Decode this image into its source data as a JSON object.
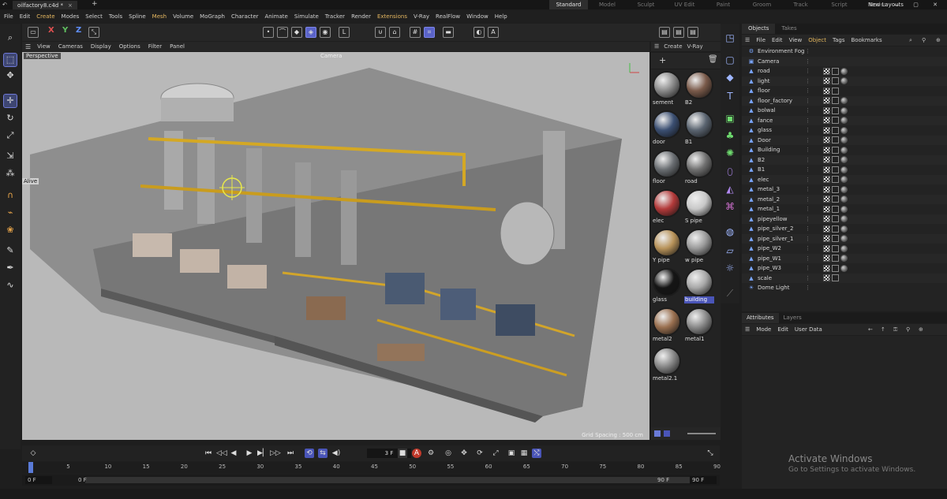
{
  "window": {
    "file_tab": "oilfactory8.c4d *",
    "close_glyph": "×",
    "plus_glyph": "+",
    "layouts": [
      "Standard",
      "Model",
      "Sculpt",
      "UV Edit",
      "Paint",
      "Groom",
      "Track",
      "Script",
      "Nodes"
    ],
    "active_layout": "Standard",
    "new_layouts": "New Layouts",
    "win_controls": "— ▢ ✕"
  },
  "menubar": [
    "File",
    "Edit",
    "Create",
    "Modes",
    "Select",
    "Tools",
    "Spline",
    "Mesh",
    "Volume",
    "MoGraph",
    "Character",
    "Animate",
    "Simulate",
    "Tracker",
    "Render",
    "Extensions",
    "V-Ray",
    "RealFlow",
    "Window",
    "Help"
  ],
  "menubar_highlight": [
    "Create",
    "Mesh",
    "Extensions"
  ],
  "toolbar": {
    "axis_x": "X",
    "axis_y": "Y",
    "axis_z": "Z",
    "axis_x_color": "#e05050",
    "axis_y_color": "#60c060",
    "axis_z_color": "#6090ff"
  },
  "viewport": {
    "menu": [
      "View",
      "Cameras",
      "Display",
      "Options",
      "Filter",
      "Panel"
    ],
    "label": "Perspective",
    "camera": "Camera",
    "grid_spacing": "Grid Spacing : 500 cm",
    "alive": "Alive"
  },
  "materials": {
    "menu": [
      "Create",
      "V-Ray"
    ],
    "items": [
      {
        "name": "sement",
        "color": "#8a8a8a"
      },
      {
        "name": "B2",
        "color": "#7a5a4a"
      },
      {
        "name": "door",
        "color": "#3b4f72"
      },
      {
        "name": "B1",
        "color": "#5a6470"
      },
      {
        "name": "floor",
        "color": "#6a6e72"
      },
      {
        "name": "road",
        "color": "#707070"
      },
      {
        "name": "elec",
        "color": "#b33a3a"
      },
      {
        "name": "S pipe",
        "color": "#c8c8c8"
      },
      {
        "name": "Y pipe",
        "color": "#b8935a"
      },
      {
        "name": "w pipe",
        "color": "#9a9a9a"
      },
      {
        "name": "glass",
        "color": "#151515"
      },
      {
        "name": "building",
        "color": "#a8a8a8"
      },
      {
        "name": "metal2",
        "color": "#9a7050"
      },
      {
        "name": "metal1",
        "color": "#8a8a8a"
      },
      {
        "name": "metal2.1",
        "color": "#888888"
      }
    ],
    "selected": "building"
  },
  "objects": {
    "tabs": [
      "Objects",
      "Takes"
    ],
    "menu": [
      "File",
      "Edit",
      "View",
      "Object",
      "Tags",
      "Bookmarks"
    ],
    "active_menu": "Object",
    "items": [
      {
        "name": "Environment Fog",
        "icon": "⚙"
      },
      {
        "name": "Camera",
        "icon": "▣"
      },
      {
        "name": "road",
        "icon": "▲"
      },
      {
        "name": "light",
        "icon": "▲"
      },
      {
        "name": "floor",
        "icon": "▲"
      },
      {
        "name": "floor_factory",
        "icon": "▲"
      },
      {
        "name": "bolwal",
        "icon": "▲"
      },
      {
        "name": "fance",
        "icon": "▲"
      },
      {
        "name": "glass",
        "icon": "▲"
      },
      {
        "name": "Door",
        "icon": "▲"
      },
      {
        "name": "Building",
        "icon": "▲"
      },
      {
        "name": "B2",
        "icon": "▲"
      },
      {
        "name": "B1",
        "icon": "▲"
      },
      {
        "name": "elec",
        "icon": "▲"
      },
      {
        "name": "metal_3",
        "icon": "▲"
      },
      {
        "name": "metal_2",
        "icon": "▲"
      },
      {
        "name": "metal_1",
        "icon": "▲"
      },
      {
        "name": "pipeyellow",
        "icon": "▲"
      },
      {
        "name": "pipe_silver_2",
        "icon": "▲"
      },
      {
        "name": "pipe_silver_1",
        "icon": "▲"
      },
      {
        "name": "pipe_W2",
        "icon": "▲"
      },
      {
        "name": "pipe_W1",
        "icon": "▲"
      },
      {
        "name": "pipe_W3",
        "icon": "▲"
      },
      {
        "name": "scale",
        "icon": "▲"
      },
      {
        "name": "Dome Light",
        "icon": "☀"
      }
    ]
  },
  "attributes": {
    "tabs": [
      "Attributes",
      "Layers"
    ],
    "menu": [
      "Mode",
      "Edit",
      "User Data"
    ]
  },
  "timeline": {
    "frame": "3 F",
    "ticks": [
      "0",
      "5",
      "10",
      "15",
      "20",
      "25",
      "30",
      "35",
      "40",
      "45",
      "50",
      "55",
      "60",
      "65",
      "70",
      "75",
      "80",
      "85",
      "90"
    ],
    "start_left": "0 F",
    "start_right": "0 F",
    "end_left": "90 F",
    "end_right": "90 F"
  },
  "watermark": {
    "line1": "Activate Windows",
    "line2": "Go to Settings to activate Windows."
  }
}
